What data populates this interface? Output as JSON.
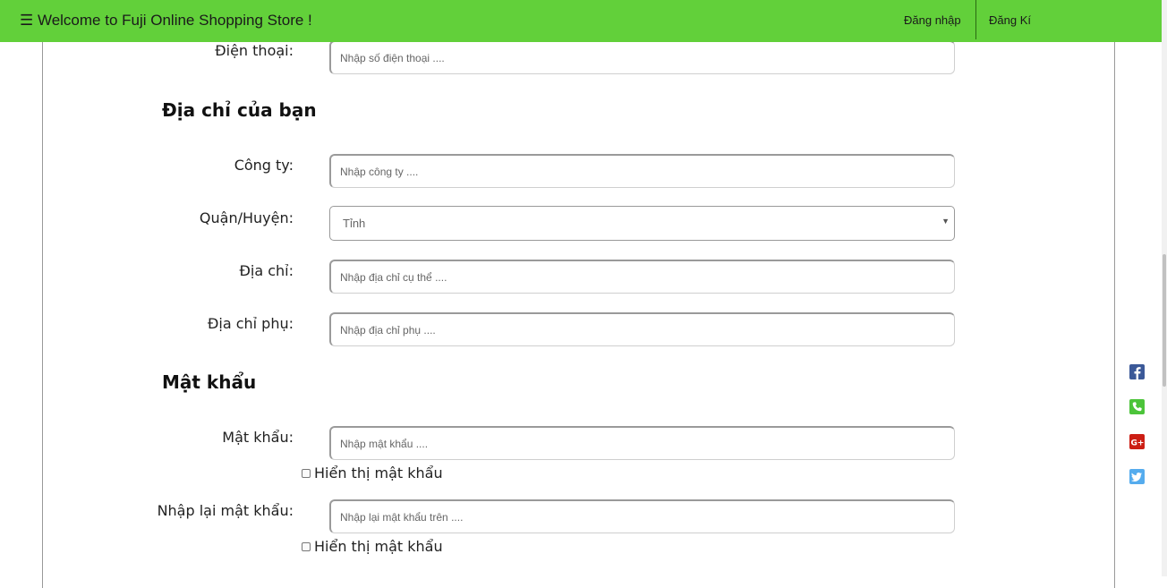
{
  "header": {
    "brand": "☰ Welcome to Fuji Online Shopping Store !",
    "login": "Đăng nhập",
    "register": "Đăng Kí"
  },
  "phone": {
    "label": "Điện thoại:",
    "placeholder": "Nhập số điện thoại ...."
  },
  "address_section": {
    "title": "Địa chỉ của bạn",
    "company_label": "Công ty:",
    "company_placeholder": "Nhập công ty ....",
    "district_label": "Quận/Huyện:",
    "district_selected": "Tỉnh",
    "address_label": "Địa chỉ:",
    "address_placeholder": "Nhập địa chỉ cụ thể ....",
    "address2_label": "Địa chỉ phụ:",
    "address2_placeholder": "Nhập địa chỉ phụ ...."
  },
  "password_section": {
    "title": "Mật khẩu",
    "password_label": "Mật khẩu:",
    "password_placeholder": "Nhập mật khẩu ....",
    "show_password_1": "Hiển thị mật khẩu",
    "confirm_label": "Nhập lại mật khẩu:",
    "confirm_placeholder": "Nhập lại mật khẩu trên ....",
    "show_password_2": "Hiển thị mật khẩu"
  },
  "social": {
    "icons": [
      "facebook-icon",
      "phone-icon",
      "google-plus-icon",
      "twitter-icon"
    ],
    "colors": {
      "facebook": "#3b5998",
      "phone": "#4cc43a",
      "google_plus": "#cc1e14",
      "twitter": "#55acee"
    }
  },
  "theme": {
    "header_bg": "#62d03a"
  }
}
